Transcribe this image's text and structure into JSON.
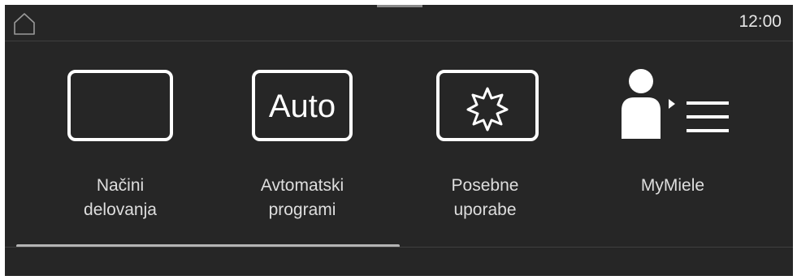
{
  "status_bar": {
    "time": "12:00",
    "home_icon": "home-icon"
  },
  "menu": {
    "items": [
      {
        "line1": "Načini",
        "line2": "delovanja",
        "icon": "blank-frame-icon"
      },
      {
        "line1": "Avtomatski",
        "line2": "programi",
        "icon": "auto-icon",
        "icon_text": "Auto"
      },
      {
        "line1": "Posebne",
        "line2": "uporabe",
        "icon": "star-burst-icon"
      },
      {
        "line1": "MyMiele",
        "line2": "",
        "icon": "user-list-icon"
      }
    ]
  },
  "scroll": {
    "position_fraction": 0.49
  },
  "colors": {
    "background": "#262626",
    "foreground": "#ffffff",
    "separator": "#404040"
  }
}
